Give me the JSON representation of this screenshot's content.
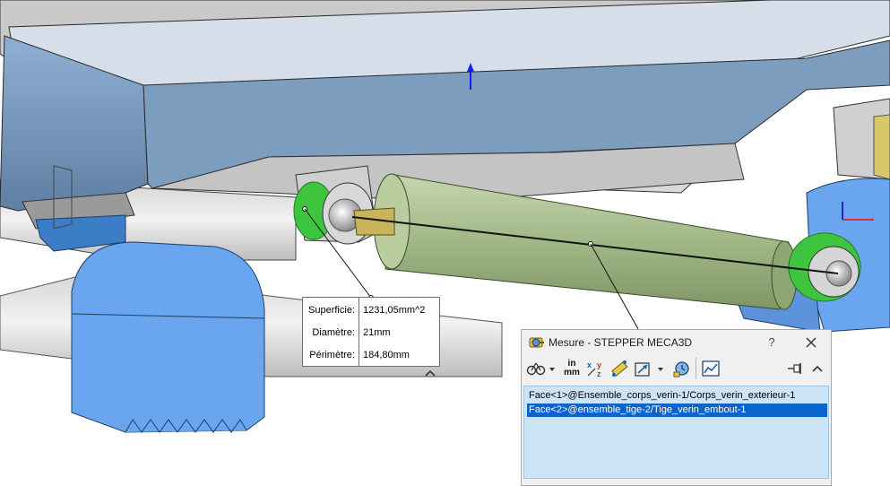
{
  "dialog": {
    "title": "Mesure - STEPPER MECA3D",
    "help_label": "?",
    "toolbar": {
      "arc_options_icon": "arc-circle-options-icon",
      "units_top": "in",
      "units_bottom": "mm",
      "xyz_icon": "xyz-measure-icon",
      "point_to_point_icon": "point-to-point-icon",
      "projection_icon": "projection-icon",
      "history_icon": "measurement-history-icon",
      "sensor_icon": "create-sensor-icon",
      "pin_icon": "pin-icon",
      "collapse_icon": "collapse-up-icon"
    },
    "selections": [
      {
        "label": "Face<1>@Ensemble_corps_verin-1/Corps_verin_exterieur-1",
        "selected": false
      },
      {
        "label": "Face<2>@ensemble_tige-2/Tige_verin_embout-1",
        "selected": true
      }
    ]
  },
  "callout": {
    "rows": [
      {
        "label": "Superficie:",
        "value": "1231,05mm^2"
      },
      {
        "label": "Diamètre:",
        "value": "21mm"
      },
      {
        "label": "Périmètre:",
        "value": "184,80mm"
      }
    ]
  },
  "colors": {
    "selection_highlight": "#0a64cc",
    "list_background": "#cde4f7",
    "face_highlight": "#22cc22",
    "cylinder_body": "#a3b98a",
    "blue_parts": "#6aa6f0",
    "frame_body": "#7c9bbd"
  }
}
